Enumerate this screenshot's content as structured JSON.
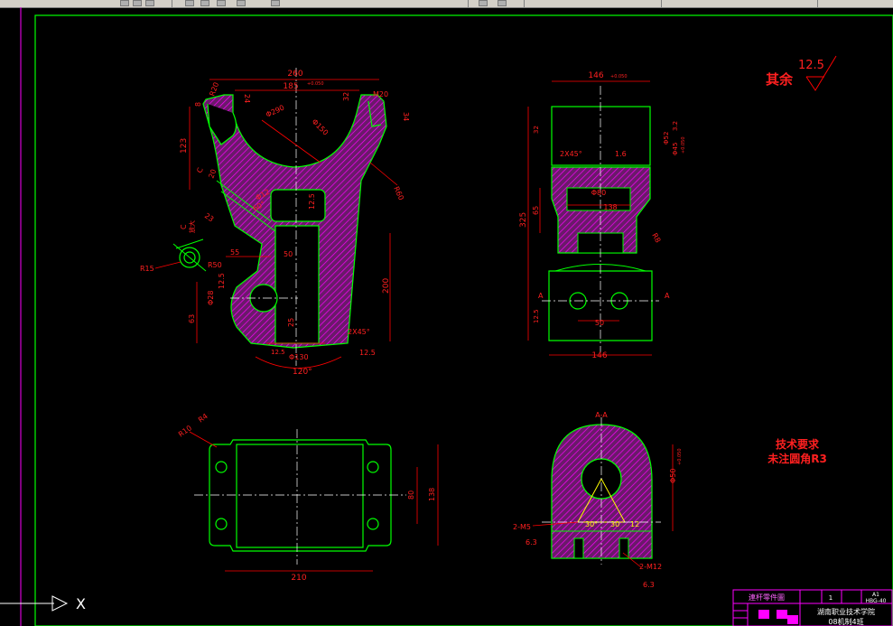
{
  "colors": {
    "background": "#000000",
    "frame": "#00ff00",
    "outline": "#00ff00",
    "dimension": "#ff0000",
    "hatch": "#ff00ff",
    "text_red": "#ff2020",
    "centerline": "#ffffff",
    "toolbar": "#d4d0c8"
  },
  "front_view": {
    "dims": [
      "260",
      "185",
      "+0.050",
      "R20",
      "8",
      "24",
      "Φ290",
      "Φ150",
      "32",
      "M20",
      "34",
      "123",
      "R60",
      "C",
      "20",
      "Φ12",
      "23",
      "60°",
      "12.5",
      "55",
      "R50",
      "50",
      "200",
      "Φ28",
      "12.5",
      "63",
      "25",
      "2X45°",
      "12.5",
      "Φ130",
      "12.5",
      "120°"
    ]
  },
  "detail_c": {
    "label": "C",
    "label2": "放大",
    "dim": "R15"
  },
  "side_view": {
    "dims": [
      "146",
      "+0.050",
      "2X45°",
      "1.6",
      "Φ52",
      "Φ45",
      "+0.050",
      "32",
      "3.2",
      "325",
      "65",
      "Φ80",
      "138",
      "R8",
      "12.5",
      "50",
      "146",
      "A",
      "A"
    ]
  },
  "top_view": {
    "dims": [
      "R4",
      "R10",
      "80",
      "138",
      "210"
    ]
  },
  "section_aa": {
    "title": "A-A",
    "dims": [
      "Φ50",
      "+0.050",
      "2-M5",
      "6.3",
      "30°",
      "30",
      "12",
      "2-M12",
      "6.3"
    ]
  },
  "roughness_note": {
    "prefix": "其余",
    "value": "12.5"
  },
  "tech_req": {
    "title": "技术要求",
    "line1": "未注圆角R3"
  },
  "title_block": {
    "part_name": "連杆零件圖",
    "qty": "1",
    "sheet": "A1",
    "drawing_no": "HBG-40",
    "school": "湖南职业技术学院",
    "class": "08机制4班"
  },
  "ucs": {
    "axis_label": "X"
  }
}
